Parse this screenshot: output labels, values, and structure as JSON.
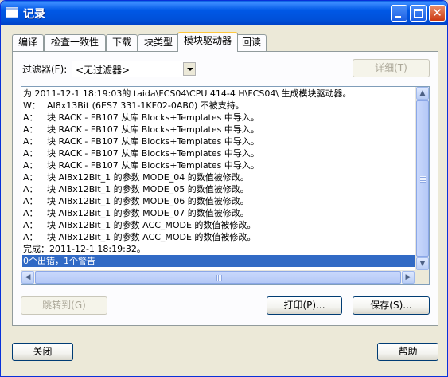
{
  "window": {
    "title": "记录"
  },
  "tabs": [
    {
      "label": "编译"
    },
    {
      "label": "检查一致性"
    },
    {
      "label": "下载"
    },
    {
      "label": "块类型"
    },
    {
      "label": "模块驱动器"
    },
    {
      "label": "回读"
    }
  ],
  "active_tab": "模块驱动器",
  "filter": {
    "label": "过滤器(F):",
    "selected": "<无过滤器>"
  },
  "details_button": "详细(T)",
  "log_lines": [
    {
      "prefix": "",
      "text": "为 2011-12-1 18:19:03的 taida\\FCS04\\CPU 414-4 H\\FCS04\\ 生成模块驱动器。"
    },
    {
      "prefix": "W：",
      "text": "AI8x13Bit (6ES7 331-1KF02-0AB0) 不被支持。"
    },
    {
      "prefix": "A：",
      "text": "块 RACK - FB107 从库 Blocks+Templates 中导入。"
    },
    {
      "prefix": "A：",
      "text": "块 RACK - FB107 从库 Blocks+Templates 中导入。"
    },
    {
      "prefix": "A：",
      "text": "块 RACK - FB107 从库 Blocks+Templates 中导入。"
    },
    {
      "prefix": "A：",
      "text": "块 RACK - FB107 从库 Blocks+Templates 中导入。"
    },
    {
      "prefix": "A：",
      "text": "块 RACK - FB107 从库 Blocks+Templates 中导入。"
    },
    {
      "prefix": "A：",
      "text": "块 AI8x12Bit_1 的参数 MODE_04 的数值被修改。"
    },
    {
      "prefix": "A：",
      "text": "块 AI8x12Bit_1 的参数 MODE_05 的数值被修改。"
    },
    {
      "prefix": "A：",
      "text": "块 AI8x12Bit_1 的参数 MODE_06 的数值被修改。"
    },
    {
      "prefix": "A：",
      "text": "块 AI8x12Bit_1 的参数 MODE_07 的数值被修改。"
    },
    {
      "prefix": "A：",
      "text": "块 AI8x12Bit_1 的参数 ACC_MODE 的数值被修改。"
    },
    {
      "prefix": "A：",
      "text": "块 AI8x12Bit_1 的参数 ACC_MODE 的数值被修改。"
    },
    {
      "prefix": "",
      "text": "完成：2011-12-1 18:19:32。"
    },
    {
      "prefix": "",
      "text": "0个出错，1个警告"
    }
  ],
  "selected_line": 14,
  "buttons": {
    "goto": "跳转到(G)",
    "print": "打印(P)...",
    "save": "保存(S)...",
    "close": "关闭",
    "help": "帮助"
  },
  "colors": {
    "titlebar": "#0058e6",
    "selection": "#316ac5",
    "active_tab_accent": "#ffc83c"
  }
}
